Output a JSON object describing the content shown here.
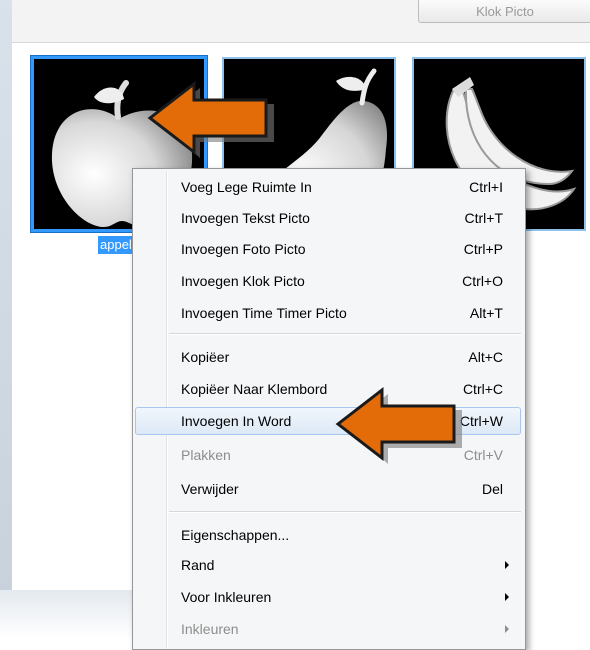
{
  "toolbar": {
    "klok_button_label": "Klok Picto"
  },
  "pictos": [
    {
      "name": "apple",
      "caption": "appel"
    },
    {
      "name": "pear",
      "caption": ""
    },
    {
      "name": "banana",
      "caption": ""
    }
  ],
  "context_menu": {
    "items": [
      {
        "label": "Voeg Lege Ruimte In",
        "shortcut": "Ctrl+I"
      },
      {
        "label": "Invoegen Tekst Picto",
        "shortcut": "Ctrl+T"
      },
      {
        "label": "Invoegen Foto Picto",
        "shortcut": "Ctrl+P"
      },
      {
        "label": "Invoegen Klok Picto",
        "shortcut": "Ctrl+O"
      },
      {
        "label": "Invoegen Time Timer Picto",
        "shortcut": "Alt+T"
      },
      {
        "label": "Kopiëer",
        "shortcut": "Alt+C"
      },
      {
        "label": "Kopiëer Naar Klembord",
        "shortcut": "Ctrl+C"
      },
      {
        "label": "Invoegen In Word",
        "shortcut": "Ctrl+W"
      },
      {
        "label": "Plakken",
        "shortcut": "Ctrl+V"
      },
      {
        "label": "Verwijder",
        "shortcut": "Del"
      },
      {
        "label": "Eigenschappen...",
        "shortcut": ""
      },
      {
        "label": "Rand",
        "shortcut": ""
      },
      {
        "label": "Voor Inkleuren",
        "shortcut": ""
      },
      {
        "label": "Inkleuren",
        "shortcut": ""
      }
    ]
  },
  "colors": {
    "selection": "#3399ff",
    "annotation_arrow": "#e36c09",
    "menu_highlight": "#dde9f7"
  },
  "icons": {
    "annotation": "arrow-left-icon",
    "submenu": "chevron-right-icon"
  }
}
